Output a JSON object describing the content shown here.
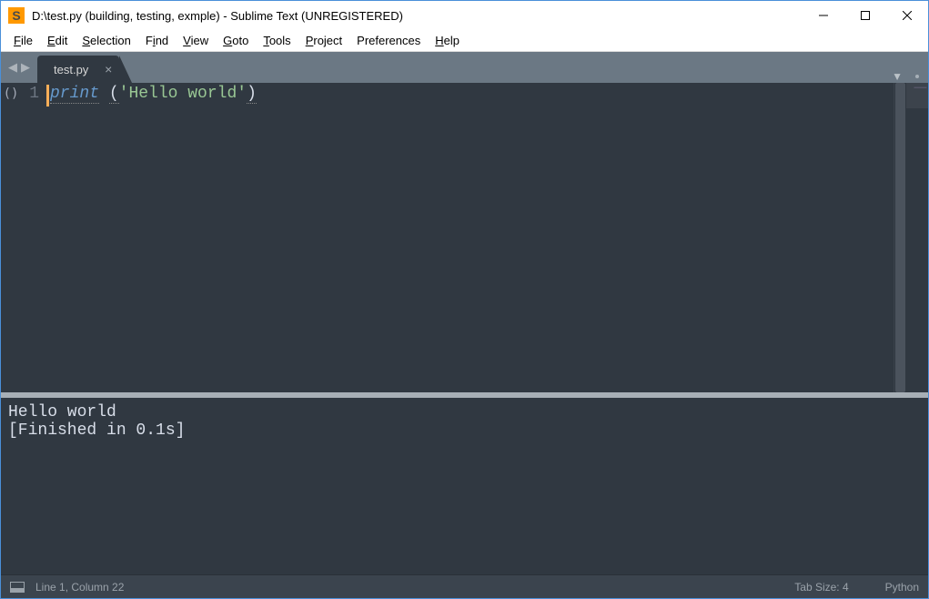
{
  "window": {
    "title": "D:\\test.py (building, testing, exmple) - Sublime Text (UNREGISTERED)"
  },
  "menu": {
    "items": [
      "File",
      "Edit",
      "Selection",
      "Find",
      "View",
      "Goto",
      "Tools",
      "Project",
      "Preferences",
      "Help"
    ]
  },
  "tabs": {
    "active": "test.py"
  },
  "editor": {
    "fold_marker": "()",
    "line_number": "1",
    "code_fn": "print",
    "code_sp": " ",
    "code_open": "(",
    "code_str": "'Hello world'",
    "code_close": ")"
  },
  "output": {
    "line1": "Hello world",
    "line2": "[Finished in 0.1s]"
  },
  "status": {
    "position": "Line 1, Column 22",
    "tab_size": "Tab Size: 4",
    "syntax": "Python"
  }
}
